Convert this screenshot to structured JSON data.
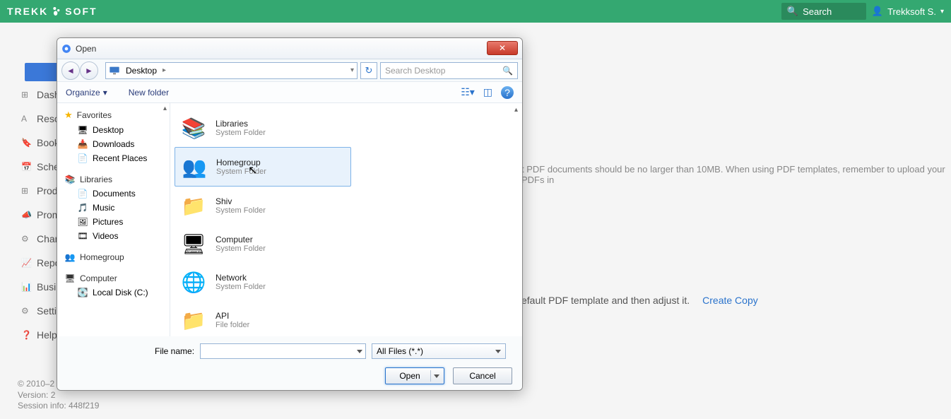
{
  "topbar": {
    "logo_left": "TREKK",
    "logo_right": "SOFT",
    "search_placeholder": "Search",
    "user_label": "Trekksoft S."
  },
  "sidebar": {
    "items": [
      {
        "icon": "⊞",
        "label": "Dash"
      },
      {
        "icon": "A",
        "label": "Reso"
      },
      {
        "icon": "🔖",
        "label": "Book"
      },
      {
        "icon": "📅",
        "label": "Sche"
      },
      {
        "icon": "⊞",
        "label": "Prod"
      },
      {
        "icon": "📣",
        "label": "Prom"
      },
      {
        "icon": "⚙",
        "label": "Chan"
      },
      {
        "icon": "📈",
        "label": "Repo"
      },
      {
        "icon": "📊",
        "label": "Busin"
      },
      {
        "icon": "⚙",
        "label": "Settin"
      },
      {
        "icon": "❓",
        "label": "Help"
      }
    ]
  },
  "bg": {
    "note": "t PDF documents should be no larger than 10MB. When using PDF templates, remember to upload your PDFs in",
    "template_hint": "efault PDF template and then adjust it.",
    "create_copy": "Create Copy"
  },
  "footer": {
    "line1": "© 2010–2",
    "line2": "Version: 2",
    "line3": "Session info: 448f219"
  },
  "dialog": {
    "title": "Open",
    "breadcrumb": "Desktop",
    "search_placeholder": "Search Desktop",
    "organize": "Organize",
    "new_folder": "New folder",
    "tree": {
      "favorites": "Favorites",
      "fav_items": [
        {
          "label": "Desktop"
        },
        {
          "label": "Downloads"
        },
        {
          "label": "Recent Places"
        }
      ],
      "libraries": "Libraries",
      "lib_items": [
        {
          "label": "Documents"
        },
        {
          "label": "Music"
        },
        {
          "label": "Pictures"
        },
        {
          "label": "Videos"
        }
      ],
      "homegroup": "Homegroup",
      "computer": "Computer",
      "local_disk": "Local Disk (C:)"
    },
    "files": [
      {
        "name": "Libraries",
        "type": "System Folder",
        "icon": "📚"
      },
      {
        "name": "Homegroup",
        "type": "System Folder",
        "icon": "👥",
        "selected": true
      },
      {
        "name": "Shiv",
        "type": "System Folder",
        "icon": "📁"
      },
      {
        "name": "Computer",
        "type": "System Folder",
        "icon": "🖥"
      },
      {
        "name": "Network",
        "type": "System Folder",
        "icon": "🌐"
      },
      {
        "name": "API",
        "type": "File folder",
        "icon": "📁"
      }
    ],
    "filename_label": "File name:",
    "filetype": "All Files (*.*)",
    "open_btn": "Open",
    "cancel_btn": "Cancel"
  }
}
